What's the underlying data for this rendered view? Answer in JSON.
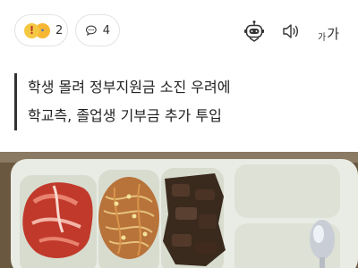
{
  "toolbar": {
    "reaction_count": "2",
    "comment_count": "4",
    "font_size_small": "가",
    "font_size_large": "가",
    "icons": [
      "reaction-emoji-icon",
      "comment-bubble-icon",
      "ai-robot-icon",
      "speaker-icon",
      "font-size-icon"
    ]
  },
  "article": {
    "title_line_1": "학생 몰려 정부지원금 소진 우려에",
    "title_line_2": "학교측, 졸업생 기부금 추가 투입"
  },
  "colors": {
    "border": "#e3e3e3",
    "title_bar": "#333333",
    "tray": "#eef0e8",
    "kimchi": "#c0392b"
  }
}
